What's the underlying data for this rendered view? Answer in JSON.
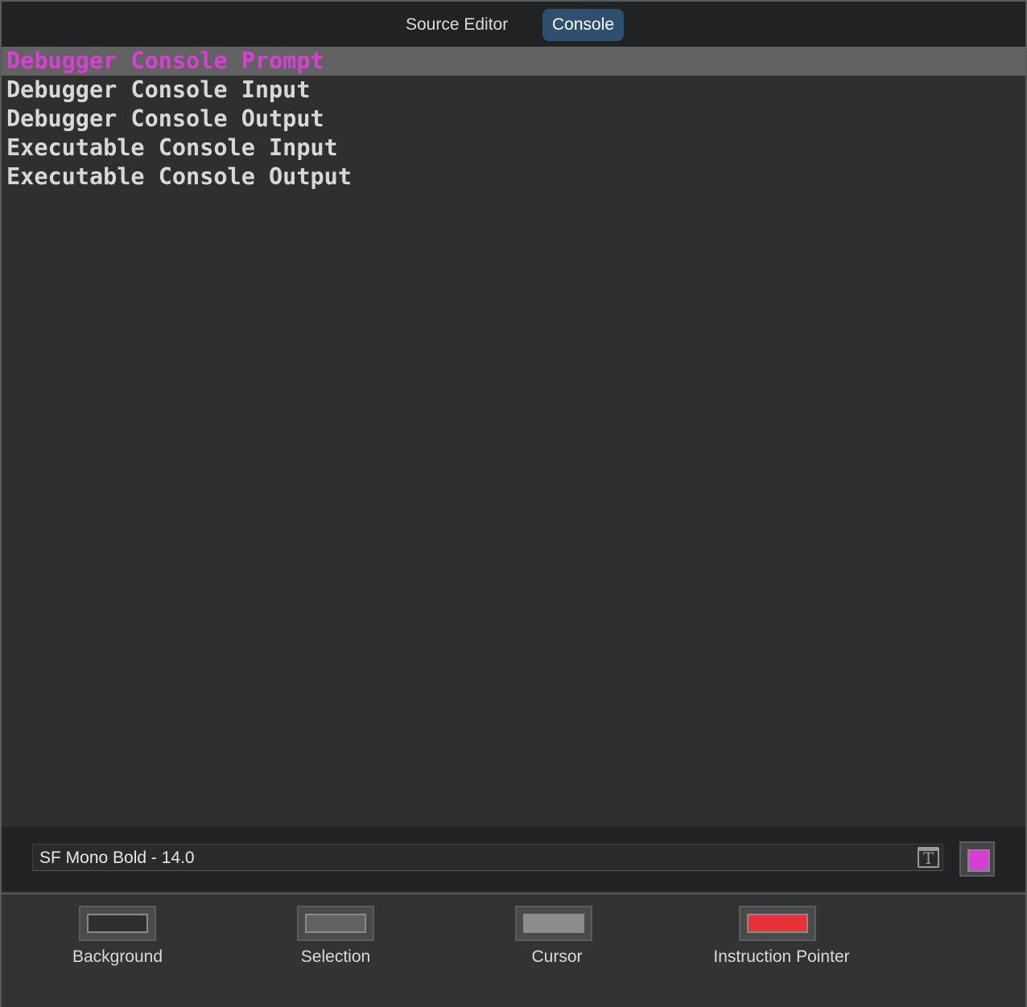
{
  "tabs": [
    {
      "label": "Source Editor",
      "active": false
    },
    {
      "label": "Console",
      "active": true
    }
  ],
  "items": [
    {
      "label": "Debugger Console Prompt",
      "color": "#d93fd6",
      "selected": true
    },
    {
      "label": "Debugger Console Input",
      "color": "#d8d8d8"
    },
    {
      "label": "Debugger Console Output",
      "color": "#d8d8d8"
    },
    {
      "label": "Executable Console Input",
      "color": "#d8d8d8"
    },
    {
      "label": "Executable Console Output",
      "color": "#d8d8d8"
    }
  ],
  "font": {
    "value": "SF Mono Bold - 14.0",
    "icon": "font-panel-icon",
    "color": "#d23fd2"
  },
  "colors": [
    {
      "label": "Background",
      "color": "#2f2f2f"
    },
    {
      "label": "Selection",
      "color": "#626262"
    },
    {
      "label": "Cursor",
      "color": "#8c8c8c"
    },
    {
      "label": "Instruction Pointer",
      "color": "#e83039"
    }
  ]
}
